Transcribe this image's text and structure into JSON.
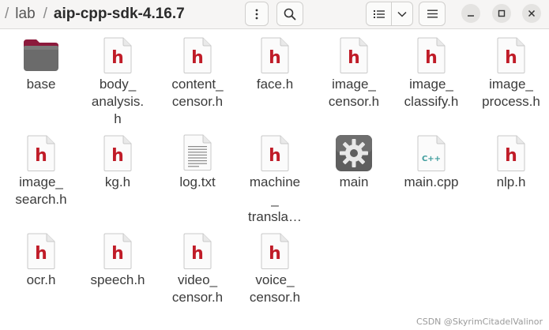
{
  "path": {
    "segments": [
      "lab",
      "aip-cpp-sdk-4.16.7"
    ]
  },
  "files": [
    {
      "name": "base",
      "type": "folder"
    },
    {
      "name": "body_\nanalysis.\nh",
      "type": "header"
    },
    {
      "name": "content_\ncensor.h",
      "type": "header"
    },
    {
      "name": "face.h",
      "type": "header"
    },
    {
      "name": "image_\ncensor.h",
      "type": "header"
    },
    {
      "name": "image_\nclassify.h",
      "type": "header"
    },
    {
      "name": "image_\nprocess.h",
      "type": "header"
    },
    {
      "name": "image_\nsearch.h",
      "type": "header"
    },
    {
      "name": "kg.h",
      "type": "header"
    },
    {
      "name": "log.txt",
      "type": "text"
    },
    {
      "name": "machine\n_\ntransla…",
      "type": "header"
    },
    {
      "name": "main",
      "type": "executable"
    },
    {
      "name": "main.cpp",
      "type": "cpp"
    },
    {
      "name": "nlp.h",
      "type": "header"
    },
    {
      "name": "ocr.h",
      "type": "header"
    },
    {
      "name": "speech.h",
      "type": "header"
    },
    {
      "name": "video_\ncensor.h",
      "type": "header"
    },
    {
      "name": "voice_\ncensor.h",
      "type": "header"
    }
  ],
  "icon_glyphs": {
    "header": "h",
    "cpp": "C++"
  },
  "colors": {
    "header_glyph": "#c01c28",
    "cpp_glyph": "#3f9d9d",
    "folder": "#6b6b6b",
    "folder_tab": "#8c1a3c"
  },
  "watermark": "CSDN @SkyrimCitadelValinor"
}
